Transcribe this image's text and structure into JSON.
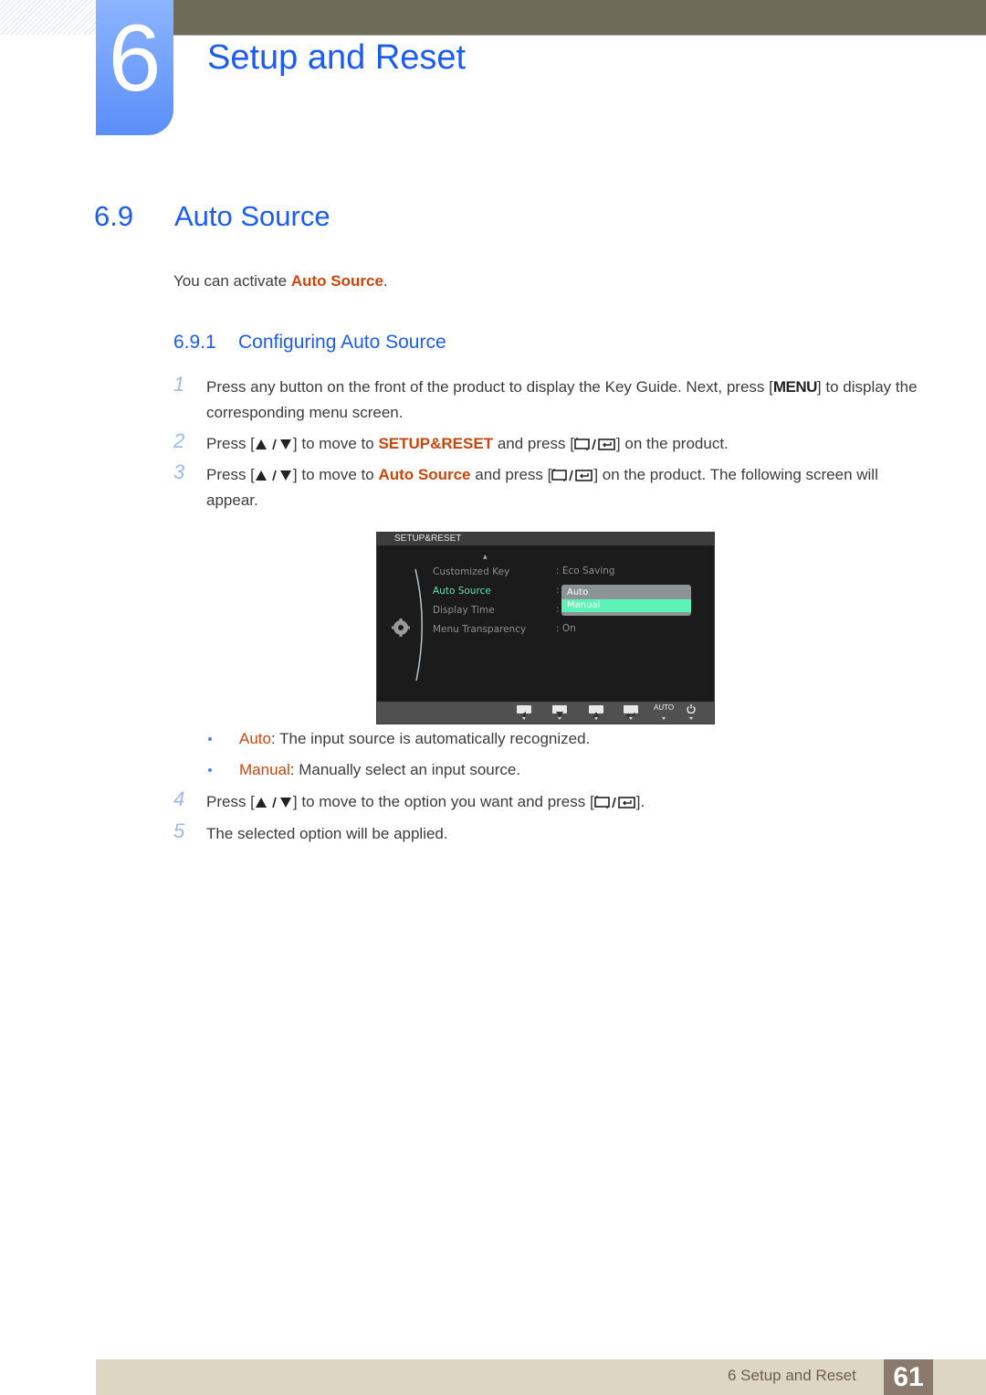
{
  "header": {
    "chapter_number": "6",
    "chapter_title": "Setup and Reset"
  },
  "section": {
    "number": "6.9",
    "title": "Auto Source",
    "intro_prefix": "You can activate ",
    "intro_highlight": "Auto Source",
    "intro_suffix": "."
  },
  "subsection": {
    "number": "6.9.1",
    "title": "Configuring Auto Source"
  },
  "steps": [
    {
      "n": "1",
      "text_a": "Press any button on the front of the product to display the Key Guide. Next, press [",
      "key": "MENU",
      "text_b": "] to display the corresponding menu screen."
    },
    {
      "n": "2",
      "text_a": "Press [",
      "text_b": "] to move to ",
      "highlight": "SETUP&RESET",
      "text_c": " and press [",
      "text_d": "] on the product."
    },
    {
      "n": "3",
      "text_a": "Press [",
      "text_b": "] to move to ",
      "highlight": "Auto Source",
      "text_c": " and press [",
      "text_d": "] on the product. The following screen will appear."
    },
    {
      "n": "4",
      "text_a": "Press [",
      "text_b": "] to move to the option you want and press [",
      "text_c": "]."
    },
    {
      "n": "5",
      "text_a": "The selected option will be applied."
    }
  ],
  "bullets": [
    {
      "term": "Auto",
      "desc": ": The input source is automatically recognized."
    },
    {
      "term": "Manual",
      "desc": ": Manually select an input source."
    }
  ],
  "osd": {
    "title": "SETUP&RESET",
    "items": [
      {
        "label": "Customized Key",
        "value": ": Eco Saving"
      },
      {
        "label": "Auto Source",
        "value": ":"
      },
      {
        "label": "Display Time",
        "value": ":"
      },
      {
        "label": "Menu Transparency",
        "value": ": On"
      }
    ],
    "dropdown_options": [
      "Auto",
      "Manual"
    ],
    "dropdown_selected": "Manual",
    "active_item": "Auto Source",
    "keybar": [
      "left-icon",
      "down-icon",
      "up-icon",
      "enter-icon",
      "AUTO",
      "power-icon"
    ],
    "auto_label": "AUTO",
    "colors": {
      "active": "#5fe3a8",
      "selected_option": "#5ef3b6"
    }
  },
  "footer": {
    "section_label": "6 Setup and Reset",
    "page_number": "61"
  },
  "colors": {
    "heading_blue": "#1c5cf0",
    "highlight_orange": "#c8460e",
    "step_number": "#9fb9ee"
  }
}
